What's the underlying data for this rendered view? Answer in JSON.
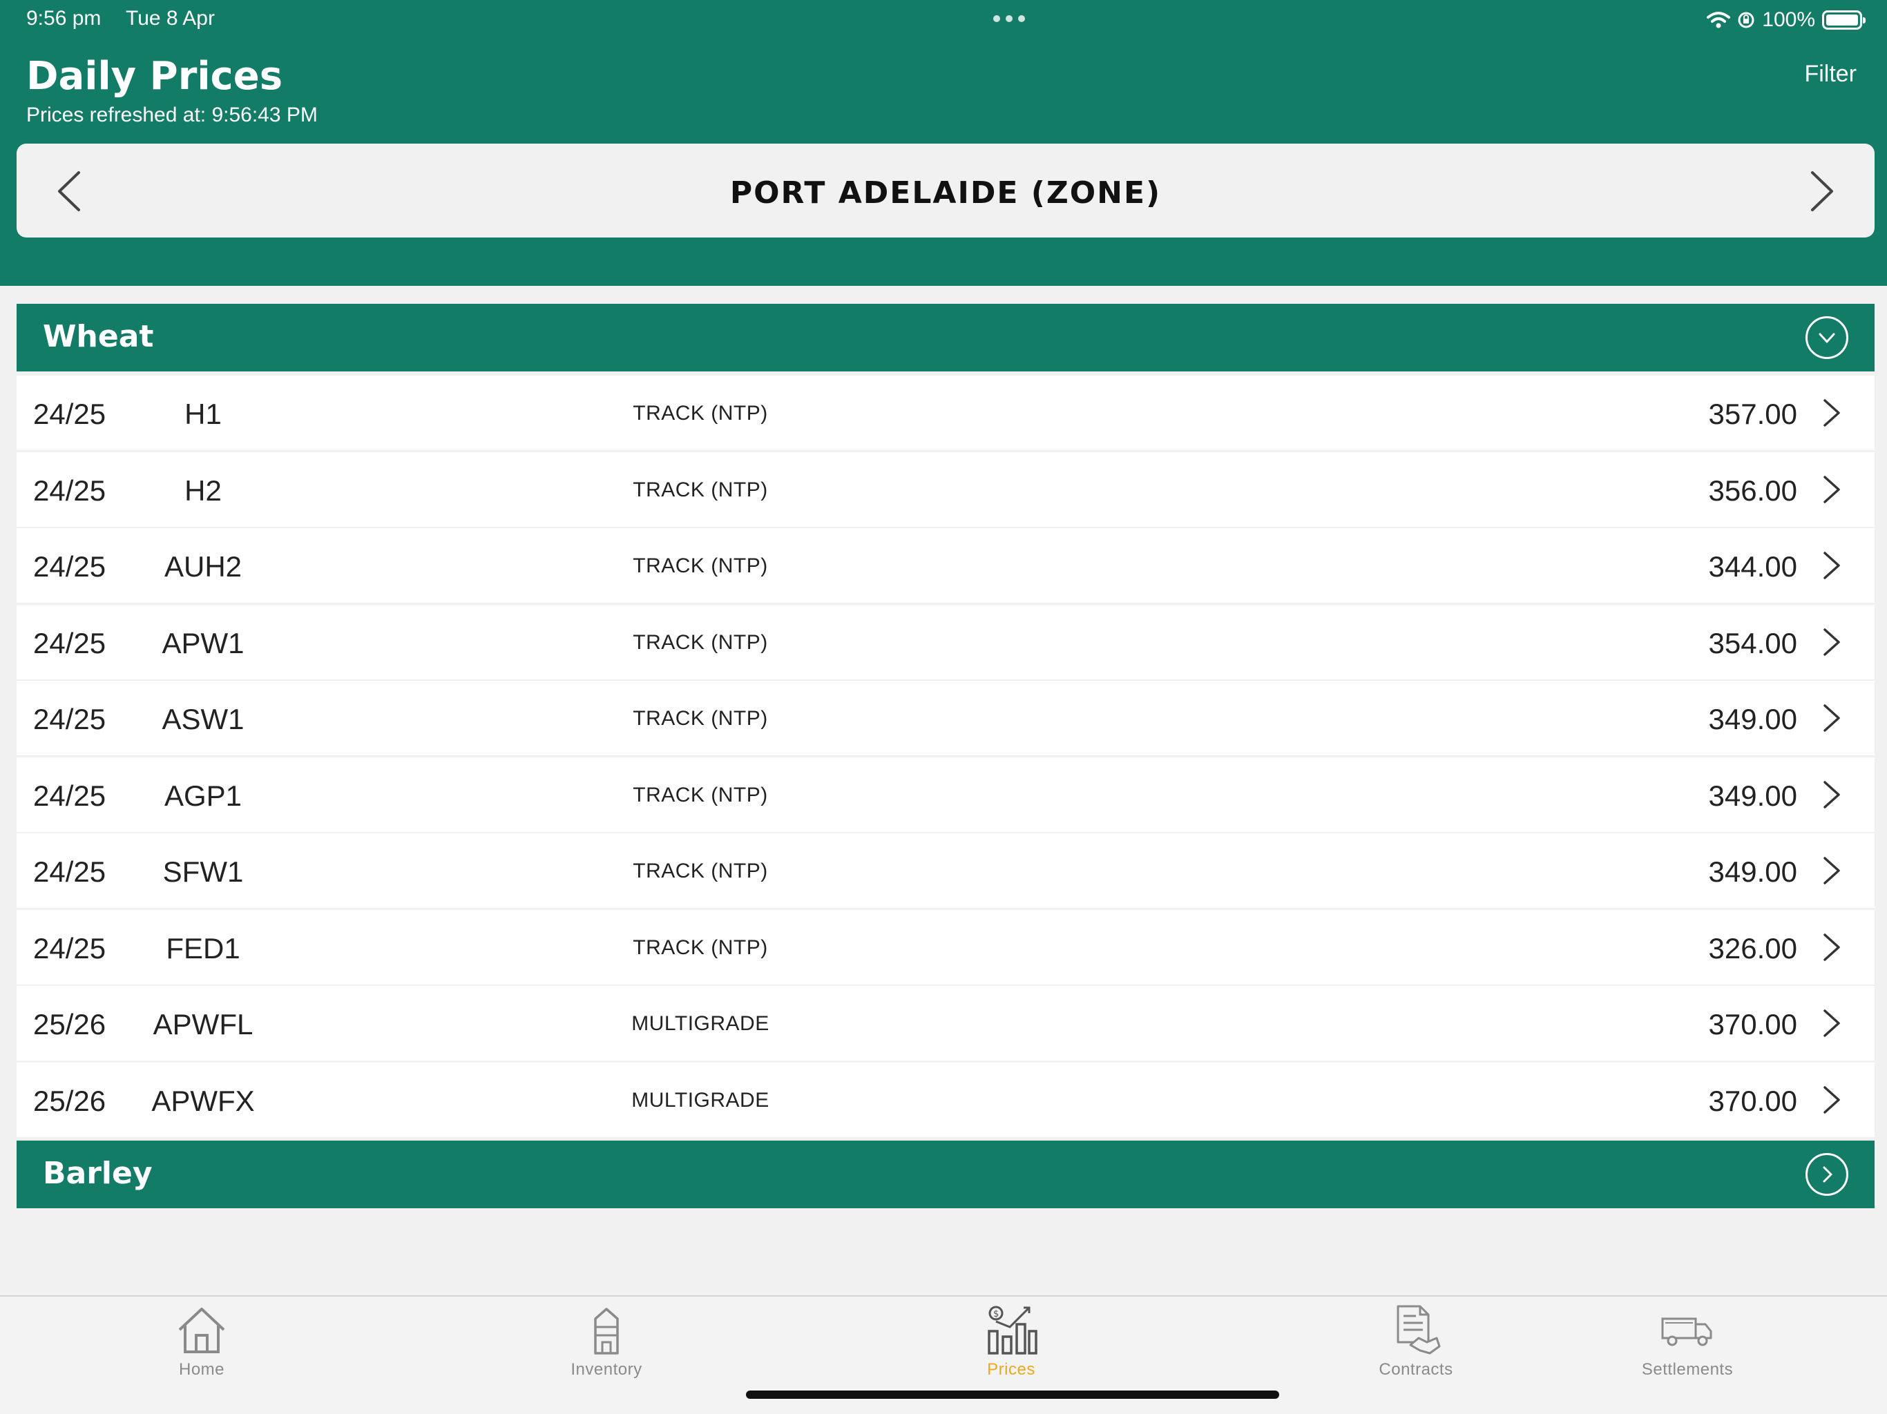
{
  "status_bar": {
    "time": "9:56 pm",
    "date": "Tue 8 Apr",
    "battery": "100%"
  },
  "header": {
    "title": "Daily Prices",
    "refreshed": "Prices refreshed at: 9:56:43 PM",
    "filter_label": "Filter"
  },
  "zone": {
    "name": "PORT ADELAIDE (ZONE)"
  },
  "sections": [
    {
      "label": "Wheat",
      "expanded": true
    },
    {
      "label": "Barley",
      "expanded": false
    }
  ],
  "rows": [
    {
      "season": "24/25",
      "grade": "H1",
      "type": "TRACK (NTP)",
      "price": "357.00"
    },
    {
      "season": "24/25",
      "grade": "H2",
      "type": "TRACK (NTP)",
      "price": "356.00"
    },
    {
      "season": "24/25",
      "grade": "AUH2",
      "type": "TRACK (NTP)",
      "price": "344.00"
    },
    {
      "season": "24/25",
      "grade": "APW1",
      "type": "TRACK (NTP)",
      "price": "354.00"
    },
    {
      "season": "24/25",
      "grade": "ASW1",
      "type": "TRACK (NTP)",
      "price": "349.00"
    },
    {
      "season": "24/25",
      "grade": "AGP1",
      "type": "TRACK (NTP)",
      "price": "349.00"
    },
    {
      "season": "24/25",
      "grade": "SFW1",
      "type": "TRACK (NTP)",
      "price": "349.00"
    },
    {
      "season": "24/25",
      "grade": "FED1",
      "type": "TRACK (NTP)",
      "price": "326.00"
    },
    {
      "season": "25/26",
      "grade": "APWFL",
      "type": "MULTIGRADE",
      "price": "370.00"
    },
    {
      "season": "25/26",
      "grade": "APWFX",
      "type": "MULTIGRADE",
      "price": "370.00"
    }
  ],
  "tabs": [
    {
      "label": "Home",
      "icon": "home-icon"
    },
    {
      "label": "Inventory",
      "icon": "silo-icon"
    },
    {
      "label": "Prices",
      "icon": "price-chart-icon",
      "active": true
    },
    {
      "label": "Contracts",
      "icon": "contract-handshake-icon"
    },
    {
      "label": "Settlements",
      "icon": "truck-icon"
    }
  ],
  "colors": {
    "brand": "#127c67",
    "active_tab": "#f0a81c",
    "background": "#f0f1f0"
  }
}
